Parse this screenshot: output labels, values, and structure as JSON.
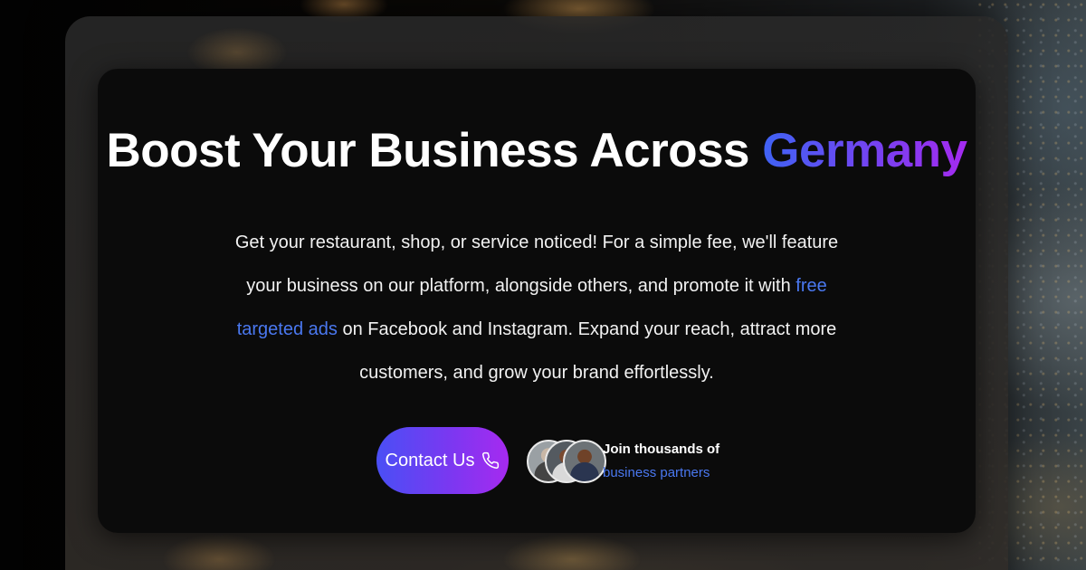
{
  "hero": {
    "headline_main": "Boost Your Business Across ",
    "headline_accent": "Germany",
    "description_before": "Get your restaurant, shop, or service noticed! For a simple fee, we'll feature your business on our platform, alongside others, and promote it with ",
    "description_link": "free targeted ads",
    "description_after": " on Facebook and Instagram. Expand your reach, attract more customers, and grow your brand effortlessly.",
    "contact_label": "Contact Us",
    "contact_icon": "phone-icon",
    "partners_line1": "Join thousands of",
    "partners_line2": "business partners"
  },
  "colors": {
    "accent_start": "#3f63f5",
    "accent_end": "#a52af0",
    "link": "#4a78f0",
    "card_background": "#0a0a0a"
  }
}
